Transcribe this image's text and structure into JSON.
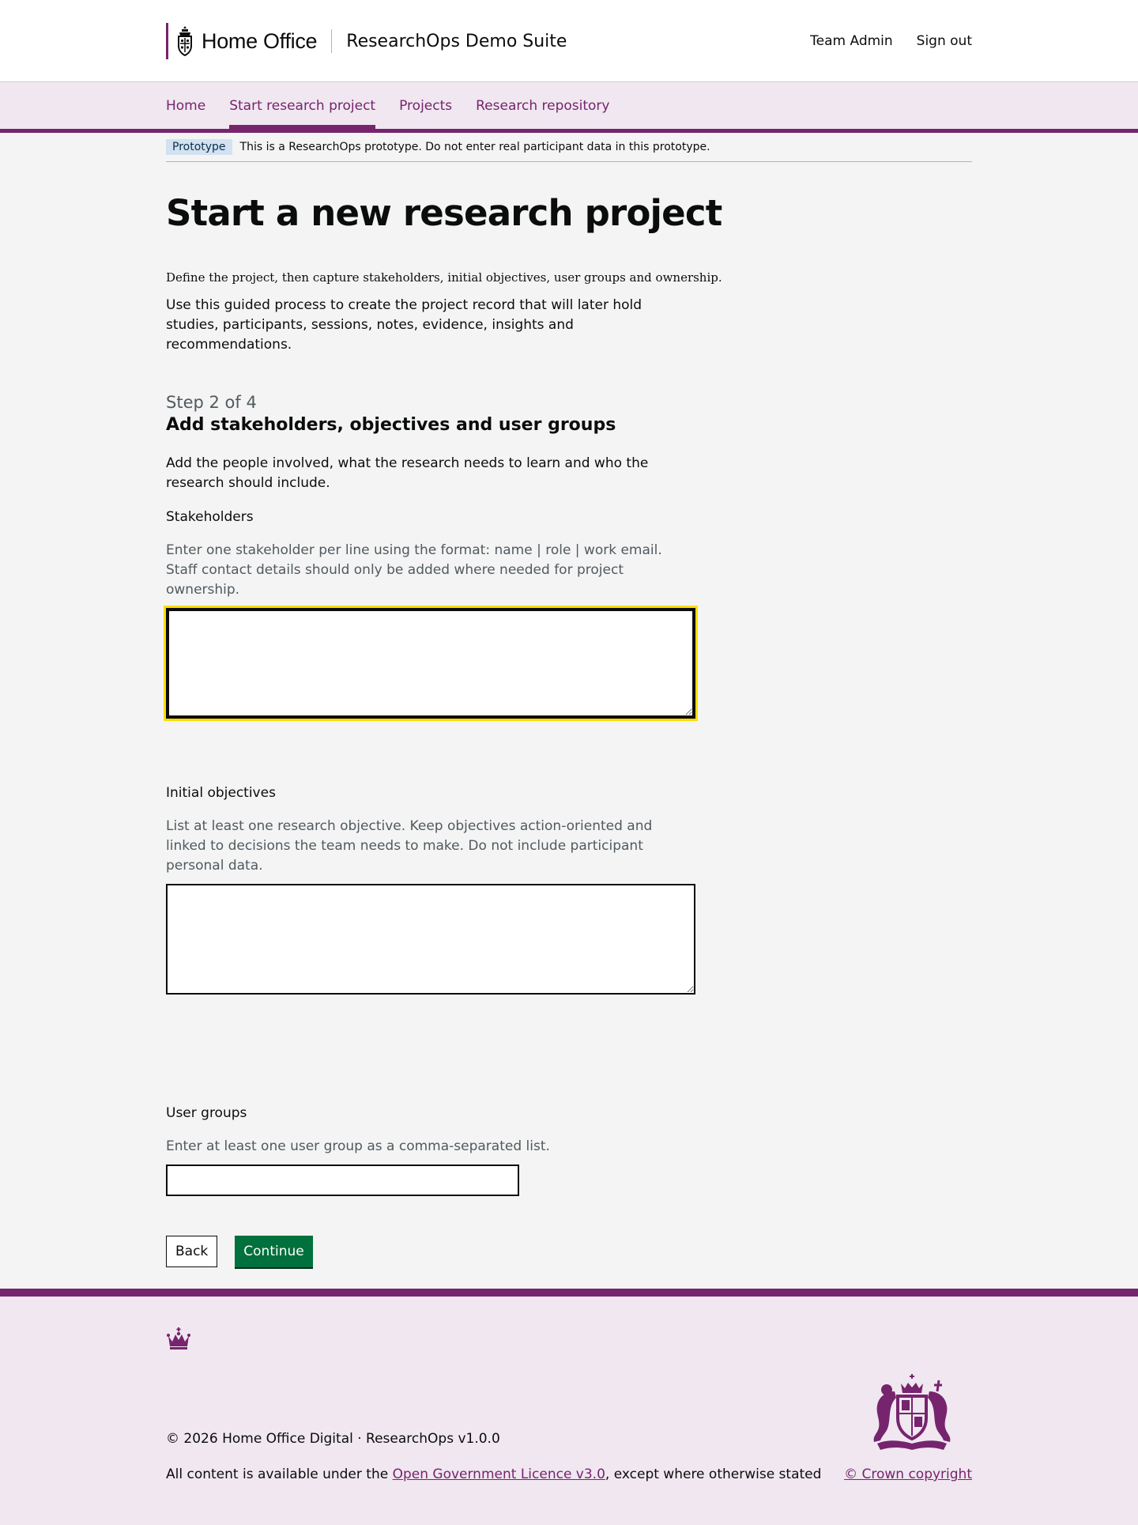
{
  "header": {
    "brand": "Home Office",
    "service": "ResearchOps Demo Suite",
    "links": [
      "Team Admin",
      "Sign out"
    ]
  },
  "nav": {
    "items": [
      "Home",
      "Start research project",
      "Projects",
      "Research repository"
    ],
    "active": "Start research project"
  },
  "phase": {
    "tag": "Prototype",
    "text": "This is a ResearchOps prototype. Do not enter real participant data in this prototype."
  },
  "main": {
    "title": "Start a new research project",
    "intro": "Define the project, then capture stakeholders, initial objectives, user groups and ownership.",
    "lead": "Use this guided process to create the project record that will later hold studies, participants, sessions, notes, evidence, insights and recommendations.",
    "step_caption": "Step 2 of 4",
    "step_heading": "Add stakeholders, objectives and user groups",
    "step_description": "Add the people involved, what the research needs to learn and who the research should include.",
    "stakeholders": {
      "label": "Stakeholders",
      "hint": "Enter one stakeholder per line using the format: name | role | work email. Staff contact details should only be added where needed for project ownership.",
      "value": ""
    },
    "objectives": {
      "label": "Initial objectives",
      "hint": "List at least one research objective. Keep objectives action-oriented and linked to decisions the team needs to make. Do not include participant personal data.",
      "value": ""
    },
    "user_groups": {
      "label": "User groups",
      "hint": "Enter at least one user group as a comma-separated list.",
      "value": ""
    },
    "buttons": {
      "back": "Back",
      "continue": "Continue"
    }
  },
  "footer": {
    "version": "© 2026 Home Office Digital · ResearchOps v1.0.0",
    "licence_prefix": "All content is available under the ",
    "licence_link": "Open Government Licence v3.0",
    "licence_suffix": ", except where otherwise stated",
    "copyright": "© Crown copyright"
  },
  "colors": {
    "brand": "#76246d",
    "nav_background": "#f0e7f0",
    "continue_button": "#00703c",
    "focus": "#ffdd00",
    "phase_tag": "#d2e2f1"
  },
  "icons": [
    "crest-icon",
    "crown-icon",
    "royal-arms-icon"
  ]
}
